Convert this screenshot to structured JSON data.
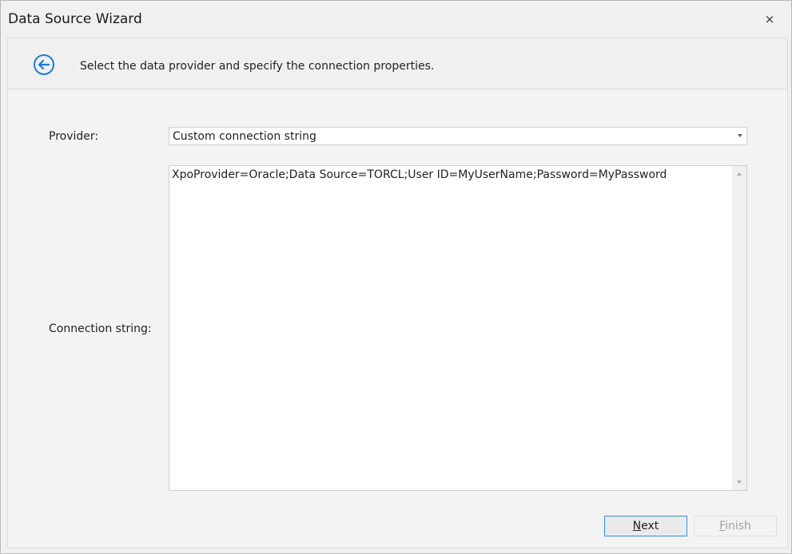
{
  "window": {
    "title": "Data Source Wizard",
    "close_glyph": "×"
  },
  "header": {
    "back_icon": "back-arrow-circle-icon",
    "instruction": "Select the data provider and specify the connection properties."
  },
  "form": {
    "provider_label": "Provider:",
    "provider_value": "Custom connection string",
    "connection_label": "Connection string:",
    "connection_value": "XpoProvider=Oracle;Data Source=TORCL;User ID=MyUserName;Password=MyPassword"
  },
  "buttons": {
    "next": {
      "access_key": "N",
      "rest": "ext",
      "enabled": true
    },
    "finish": {
      "access_key": "F",
      "rest": "inish",
      "enabled": false
    }
  },
  "colors": {
    "accent": "#1e7bd6",
    "focus_border": "#3a8ee6",
    "disabled_text": "#a0a0a0"
  }
}
